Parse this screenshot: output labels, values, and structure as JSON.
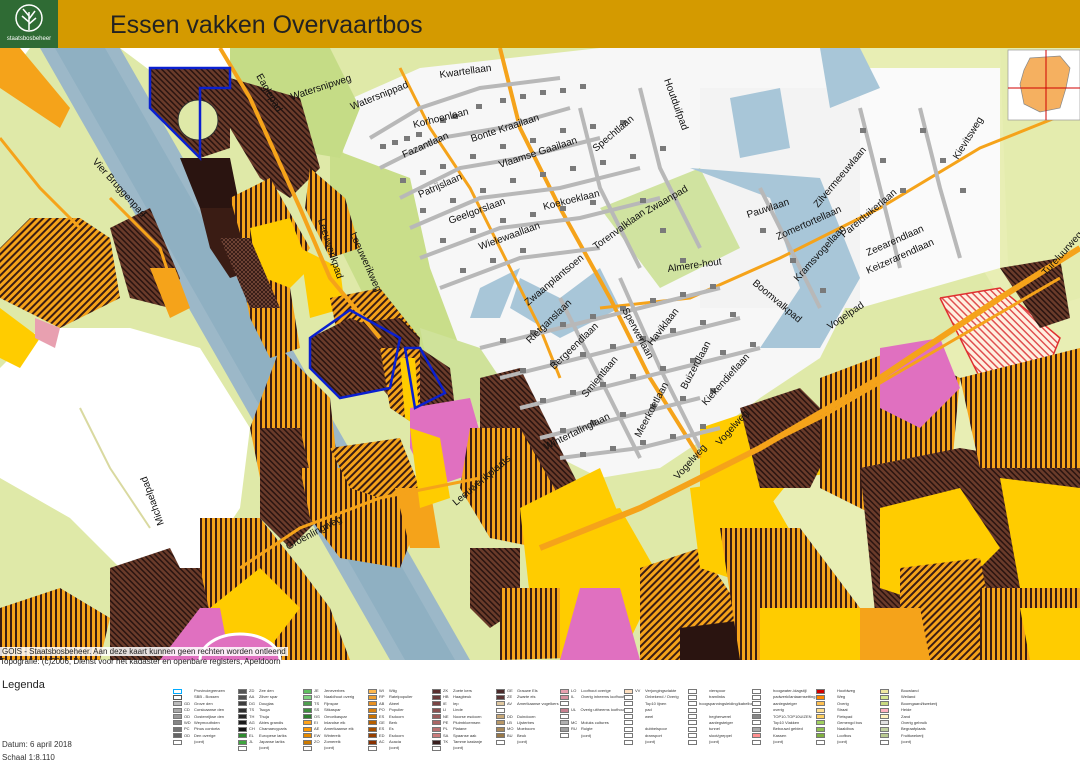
{
  "header": {
    "title": "Essen vakken Overvaartbos",
    "logo_text": "staatsbosbeheer"
  },
  "map": {
    "streets": [
      {
        "text": "Eaglepad"
      },
      {
        "text": "Watersnipweg"
      },
      {
        "text": "Watersnippad"
      },
      {
        "text": "Kwartellaan"
      },
      {
        "text": "Korhoenlaan"
      },
      {
        "text": "Houtduifpad"
      },
      {
        "text": "Bonte Kraailaan"
      },
      {
        "text": "Fazantlaan"
      },
      {
        "text": "Vlaamse Gaailaan"
      },
      {
        "text": "Spechtlaan"
      },
      {
        "text": "Patrijslaan"
      },
      {
        "text": "Geelgorslaan"
      },
      {
        "text": "Koekoeklaan"
      },
      {
        "text": "Zwaanpad"
      },
      {
        "text": "Wielewaallaan"
      },
      {
        "text": "Vier Bruggenpad"
      },
      {
        "text": "Leeuwerikpad"
      },
      {
        "text": "Leeuwerikweg"
      },
      {
        "text": "Torenvalklaan"
      },
      {
        "text": "Almere-hout"
      },
      {
        "text": "Zwaanplantsoen"
      },
      {
        "text": "Rietganslaan"
      },
      {
        "text": "Sperwerlaan"
      },
      {
        "text": "Boomvalkpad"
      },
      {
        "text": "Bergeendlaan"
      },
      {
        "text": "Haviklaan"
      },
      {
        "text": "Smientlaan"
      },
      {
        "text": "Buizerdlaan"
      },
      {
        "text": "Kiekendieflaan"
      },
      {
        "text": "Meerkoetlaan"
      },
      {
        "text": "Wintertalinglaan"
      },
      {
        "text": "Leeuwerikplaats"
      },
      {
        "text": "Vogelweg"
      },
      {
        "text": "Vogelweg"
      },
      {
        "text": "Vogelpad"
      },
      {
        "text": "Michaelpad"
      },
      {
        "text": "Groenlingweg"
      },
      {
        "text": "Pauwlaan"
      },
      {
        "text": "Zilvermeeuwlaan"
      },
      {
        "text": "Zomertortellaan"
      },
      {
        "text": "Pareiduikerlaan"
      },
      {
        "text": "Kramsvogellaan"
      },
      {
        "text": "Zeearendlaan"
      },
      {
        "text": "Keizerarendlaan"
      },
      {
        "text": "Kievitsweg"
      },
      {
        "text": "Tureluurweg"
      }
    ],
    "credits": "GOIS - Staatsbosbeheer. Aan deze kaart kunnen geen rechten worden ontleend",
    "topografie": "Topografie: (c)2006, Dienst voor het kadaster en openbare registers, Apeldoorn"
  },
  "legend": {
    "title": "Legenda",
    "datum": "Datum: 6 april 2018",
    "schaal": "Schaal 1:8.110",
    "columns": [
      [
        {
          "code": "",
          "label": "Provinciegrenzen",
          "color": "#ffffff",
          "border": "#00aaff"
        },
        {
          "code": "",
          "label": "SBB - Bossen",
          "color": "#ffffff",
          "border": "#555555"
        },
        {
          "code": "GD",
          "label": "Grove den",
          "color": "#bdbdbd"
        },
        {
          "code": "CD",
          "label": "Corsicaanse den",
          "color": "#a8a8a8"
        },
        {
          "code": "OD",
          "label": "Oostenrijkse den",
          "color": "#979797"
        },
        {
          "code": "WD",
          "label": "Weymouthden",
          "color": "#868686"
        },
        {
          "code": "PC",
          "label": "Pinus contorta",
          "color": "#757575"
        },
        {
          "code": "OD",
          "label": "Den overige",
          "color": "#646464"
        },
        {
          "code": "",
          "label": "(cont)",
          "color": "#ffffff"
        }
      ],
      [
        {
          "code": "ZD",
          "label": "Zee den",
          "color": "#545454"
        },
        {
          "code": "AA",
          "label": "Zilver spar",
          "color": "#505050"
        },
        {
          "code": "DG",
          "label": "Douglas",
          "color": "#3d3d3d"
        },
        {
          "code": "TS",
          "label": "Tsuga",
          "color": "#2f2f2f"
        },
        {
          "code": "TH",
          "label": "Thuja",
          "color": "#262626"
        },
        {
          "code": "AG",
          "label": "Abies grandis",
          "color": "#1c1c1c"
        },
        {
          "code": "CH",
          "label": "Chamaecyparis",
          "color": "#141414"
        },
        {
          "code": "EL",
          "label": "Europese lariks",
          "color": "#2e8b2e"
        },
        {
          "code": "JL",
          "label": "Japanse lariks",
          "color": "#3fa53f"
        },
        {
          "code": "",
          "label": "(cont)",
          "color": "#ffffff"
        }
      ],
      [
        {
          "code": "JE",
          "label": "Jeneverbes",
          "color": "#5fbf5f"
        },
        {
          "code": "NO",
          "label": "Naaldhout overig",
          "color": "#7fd37f"
        },
        {
          "code": "TS",
          "label": "Fijnspar",
          "color": "#4f9f4f"
        },
        {
          "code": "SS",
          "label": "Sitkaspar",
          "color": "#3f8f3f"
        },
        {
          "code": "OS",
          "label": "Omorikaspar",
          "color": "#2f7f2f"
        },
        {
          "code": "EI",
          "label": "Inlandse eik",
          "color": "#ffa31a"
        },
        {
          "code": "AE",
          "label": "Amerikaanse eik",
          "color": "#ff9900"
        },
        {
          "code": "EW",
          "label": "Wintereik",
          "color": "#e68a00"
        },
        {
          "code": "ZO",
          "label": "Zomereik",
          "color": "#cc7a00"
        },
        {
          "code": "",
          "label": "(cont)",
          "color": "#ffffff"
        }
      ],
      [
        {
          "code": "WI",
          "label": "Wilg",
          "color": "#ffb84d"
        },
        {
          "code": "RP",
          "label": "Ratelpopulier",
          "color": "#f0a030"
        },
        {
          "code": "AB",
          "label": "Abeel",
          "color": "#e89020"
        },
        {
          "code": "PO",
          "label": "Populier",
          "color": "#d88010"
        },
        {
          "code": "ES",
          "label": "Esdoorn",
          "color": "#c87000"
        },
        {
          "code": "GE",
          "label": "Berk",
          "color": "#b86000"
        },
        {
          "code": "ES",
          "label": "Es",
          "color": "#a85000"
        },
        {
          "code": "ED",
          "label": "Esdoorn",
          "color": "#984000"
        },
        {
          "code": "AC",
          "label": "Acacia",
          "color": "#883000"
        },
        {
          "code": "",
          "label": "(cont)",
          "color": "#ffffff"
        }
      ],
      [
        {
          "code": "ZK",
          "label": "Zoete kers",
          "color": "#5a2f2f"
        },
        {
          "code": "HB",
          "label": "Haagbeuk",
          "color": "#6a3a3a"
        },
        {
          "code": "IE",
          "label": "Iep",
          "color": "#7a4545"
        },
        {
          "code": "LI",
          "label": "Linde",
          "color": "#8a5050"
        },
        {
          "code": "NE",
          "label": "Noorse esdoorn",
          "color": "#9a5b5b"
        },
        {
          "code": "PE",
          "label": "Pluimbloemsen",
          "color": "#aa6666"
        },
        {
          "code": "PL",
          "label": "Platane",
          "color": "#ba7171"
        },
        {
          "code": "SA",
          "label": "Spaanse aak",
          "color": "#ca7c7c"
        },
        {
          "code": "TK",
          "label": "Tamme kastanje",
          "color": "#3a1f1f"
        },
        {
          "code": "",
          "label": "(cont)",
          "color": "#ffffff"
        }
      ],
      [
        {
          "code": "GE",
          "label": "Grauwe Els",
          "color": "#4a2a2a"
        },
        {
          "code": "ZE",
          "label": "Zwarte els",
          "color": "#5a3535"
        },
        {
          "code": "AV",
          "label": "Amerikaanse vogelkers",
          "color": "#e0c8a0"
        },
        {
          "code": "",
          "label": "",
          "color": "#ffffff"
        },
        {
          "code": "DD",
          "label": "Duindoorn",
          "color": "#c8a878"
        },
        {
          "code": "LB",
          "label": "Lijsterbes",
          "color": "#b89868"
        },
        {
          "code": "MO",
          "label": "Moeboom",
          "color": "#a88858"
        },
        {
          "code": "BU",
          "label": "Beuk",
          "color": "#987848"
        },
        {
          "code": "",
          "label": "(cont)",
          "color": "#ffffff"
        }
      ],
      [
        {
          "code": "LO",
          "label": "Loofhout overige",
          "color": "#e8a0b0"
        },
        {
          "code": "IL",
          "label": "Overig inheems loofhout",
          "color": "#d890a0"
        },
        {
          "code": "",
          "label": "",
          "color": "#ffffff"
        },
        {
          "code": "UL",
          "label": "Overig uitheems loofhout",
          "color": "#c88090"
        },
        {
          "code": "",
          "label": "",
          "color": "#ffffff"
        },
        {
          "code": "MC",
          "label": "Moluks cultures",
          "color": "#b0b0b0"
        },
        {
          "code": "RU",
          "label": "Ruigte",
          "color": "#a0a0a0"
        },
        {
          "code": "",
          "label": "(cont)",
          "color": "#ffffff"
        }
      ],
      [
        {
          "code": "VV",
          "label": "Verjongingsvlakte",
          "color": "#ffe0c0"
        },
        {
          "code": "",
          "label": "Onbekend / Overig",
          "color": "#ffffff"
        },
        {
          "code": "",
          "label": "Top10 lijnen",
          "color": "#ffffff"
        },
        {
          "code": "",
          "label": "pad",
          "color": "#ffffff"
        },
        {
          "code": "",
          "label": "weel",
          "color": "#ffffff"
        },
        {
          "code": "",
          "label": "",
          "color": "#ffffff"
        },
        {
          "code": "",
          "label": "dubbelspoor",
          "color": "#ffffff"
        },
        {
          "code": "",
          "label": "dransport",
          "color": "#ffffff"
        },
        {
          "code": "",
          "label": "(cont)",
          "color": "#ffffff"
        }
      ],
      [
        {
          "code": "",
          "label": "vierspoor",
          "color": "#ffffff"
        },
        {
          "code": "",
          "label": "tramlinks",
          "color": "#ffffff"
        },
        {
          "code": "",
          "label": "hoogspanningsleiding/kabelbaan",
          "color": "#ffffff"
        },
        {
          "code": "",
          "label": "",
          "color": "#ffffff"
        },
        {
          "code": "",
          "label": "hegherwerel",
          "color": "#ffffff"
        },
        {
          "code": "",
          "label": "aanlegsteiger",
          "color": "#ffffff"
        },
        {
          "code": "",
          "label": "tunnel",
          "color": "#ffffff"
        },
        {
          "code": "",
          "label": "sloot/greppel",
          "color": "#ffffff"
        },
        {
          "code": "",
          "label": "(cont)",
          "color": "#ffffff"
        }
      ],
      [
        {
          "code": "",
          "label": "hoogwater-/dagstijl",
          "color": "#ffffff"
        },
        {
          "code": "",
          "label": "padwerk/lantaarnsetting",
          "color": "#ffffff"
        },
        {
          "code": "",
          "label": "aanlegsteiger",
          "color": "#ffffff"
        },
        {
          "code": "",
          "label": "overig",
          "color": "#ffffff"
        },
        {
          "code": "",
          "label": "TOP10-TOP10UIZEN",
          "color": "#888888"
        },
        {
          "code": "",
          "label": "Top10 Vlakken",
          "color": "#ffffff"
        },
        {
          "code": "",
          "label": "Bebouwd gebied",
          "color": "#aaaaaa"
        },
        {
          "code": "",
          "label": "Kassen",
          "color": "#ff9090"
        },
        {
          "code": "",
          "label": "(cont)",
          "color": "#ffffff"
        }
      ],
      [
        {
          "code": "",
          "label": "Hoofdweg",
          "color": "#d00000"
        },
        {
          "code": "",
          "label": "Weg",
          "color": "#ff8800"
        },
        {
          "code": "",
          "label": "Overig",
          "color": "#ffc050"
        },
        {
          "code": "",
          "label": "Straat",
          "color": "#ffe090"
        },
        {
          "code": "",
          "label": "Fietspad",
          "color": "#ffd060"
        },
        {
          "code": "",
          "label": "Gemengd bos",
          "color": "#a0d060"
        },
        {
          "code": "",
          "label": "Naaldbos",
          "color": "#90c050"
        },
        {
          "code": "",
          "label": "Loofbos",
          "color": "#80b040"
        },
        {
          "code": "",
          "label": "(cont)",
          "color": "#ffffff"
        }
      ],
      [
        {
          "code": "",
          "label": "Bouwland",
          "color": "#f0e8a0"
        },
        {
          "code": "",
          "label": "Weiland",
          "color": "#d8e890"
        },
        {
          "code": "",
          "label": "Boomgaard/kwekerij",
          "color": "#c8d880"
        },
        {
          "code": "",
          "label": "Heide",
          "color": "#ffb0c0"
        },
        {
          "code": "",
          "label": "Zand",
          "color": "#fff0c0"
        },
        {
          "code": "",
          "label": "Overig gebruik",
          "color": "#e0e0e0"
        },
        {
          "code": "",
          "label": "Begraafplaats",
          "color": "#c0d0a0"
        },
        {
          "code": "",
          "label": "Fruitkwekerij",
          "color": "#b8c890"
        },
        {
          "code": "",
          "label": "(cont)",
          "color": "#ffffff"
        }
      ]
    ]
  }
}
